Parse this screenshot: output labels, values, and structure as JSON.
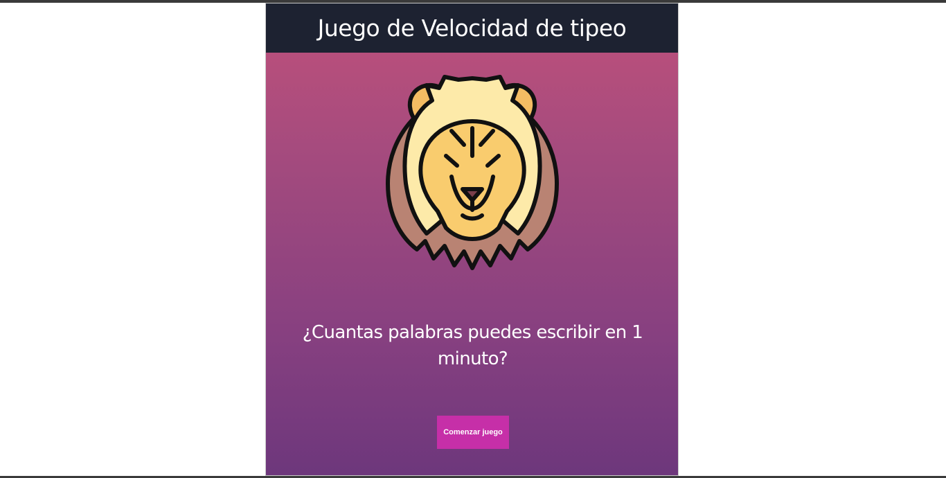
{
  "header": {
    "title": "Juego de Velocidad de tipeo"
  },
  "hero": {
    "image_icon": "lion-icon"
  },
  "main": {
    "question_line1": "¿Cuantas palabras puedes escribir en 1",
    "question_line2": "minuto?",
    "start_button_label": "Comenzar juego"
  },
  "colors": {
    "header_bg": "#1d2231",
    "gradient_top": "#c0517b",
    "gradient_bottom": "#6d377c",
    "button_bg": "#c62fa8"
  }
}
